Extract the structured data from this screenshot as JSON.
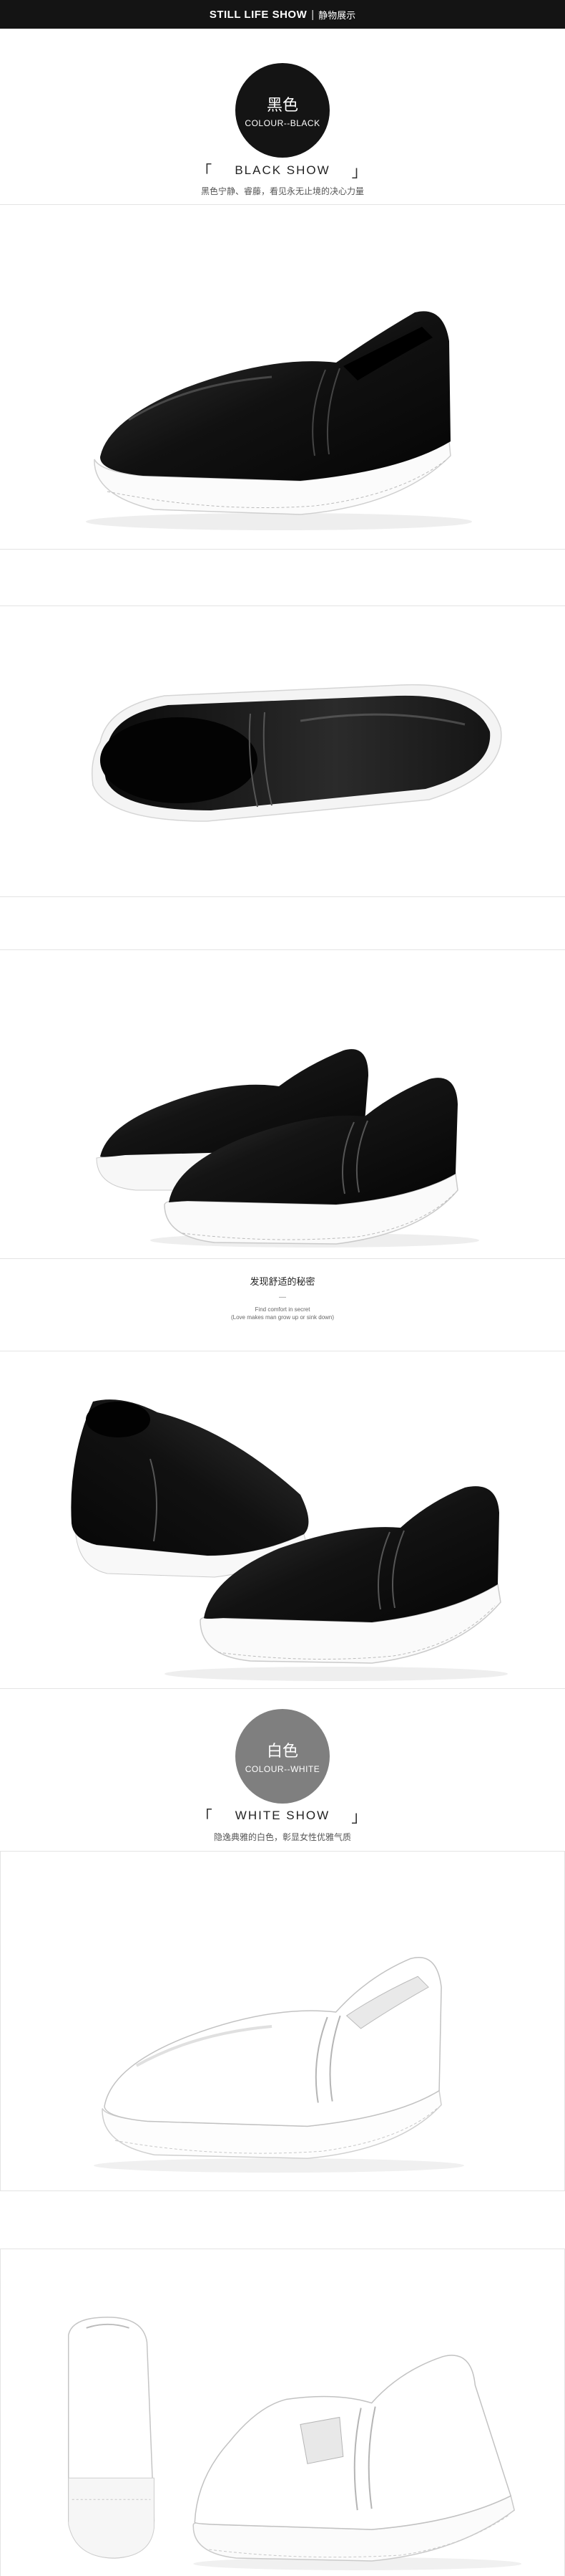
{
  "header": {
    "title": "STILL LIFE SHOW",
    "separator": "|",
    "subtitle": "静物展示"
  },
  "black_section": {
    "circle_cn": "黑色",
    "circle_en": "COLOUR--BLACK",
    "show_title": "BLACK SHOW",
    "description": "黑色宁静、睿藤，看见永无止境的决心力量"
  },
  "comfort_note": {
    "heading": "发现舒适的秘密",
    "dash": "—",
    "line1": "Find comfort in secret",
    "line2": "(Love makes man grow up or sink down)"
  },
  "white_section": {
    "circle_cn": "白色",
    "circle_en": "COLOUR--WHITE",
    "show_title": "WHITE SHOW",
    "description": "隐逸典雅的白色，彰显女性优雅气质"
  },
  "brackets": {
    "left": "「",
    "right": "」"
  },
  "colors": {
    "topbar": "#141414",
    "black_circle": "#141414",
    "white_circle": "#7f7f7f",
    "border": "#e4e4e4"
  }
}
